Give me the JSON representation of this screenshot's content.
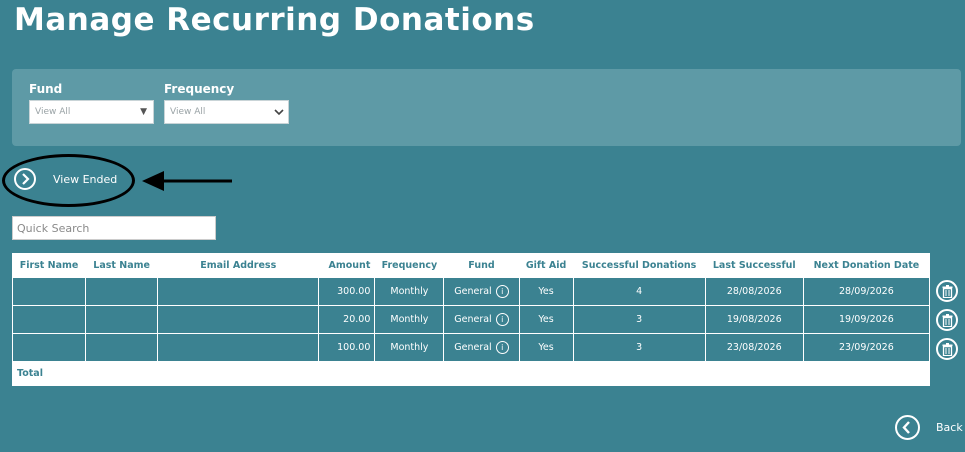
{
  "page": {
    "title": "Manage Recurring Donations"
  },
  "filters": {
    "fund": {
      "label": "Fund",
      "value": "View All"
    },
    "frequency": {
      "label": "Frequency",
      "value": "View All"
    }
  },
  "view_ended": {
    "label": "View Ended"
  },
  "search": {
    "placeholder": "Quick Search"
  },
  "table": {
    "columns": [
      "First Name",
      "Last Name",
      "Email Address",
      "Amount",
      "Frequency",
      "Fund",
      "Gift Aid",
      "Successful Donations",
      "Last Successful",
      "Next Donation Date"
    ],
    "rows": [
      {
        "first_name": "",
        "last_name": "",
        "email": "",
        "amount": "300.00",
        "frequency": "Monthly",
        "fund": "General",
        "gift_aid": "Yes",
        "successful": "4",
        "last_successful": "28/08/2026",
        "next_date": "28/09/2026"
      },
      {
        "first_name": "",
        "last_name": "",
        "email": "",
        "amount": "20.00",
        "frequency": "Monthly",
        "fund": "General",
        "gift_aid": "Yes",
        "successful": "3",
        "last_successful": "19/08/2026",
        "next_date": "19/09/2026"
      },
      {
        "first_name": "",
        "last_name": "",
        "email": "",
        "amount": "100.00",
        "frequency": "Monthly",
        "fund": "General",
        "gift_aid": "Yes",
        "successful": "3",
        "last_successful": "23/08/2026",
        "next_date": "23/09/2026"
      }
    ],
    "total_label": "Total",
    "info_glyph": "i"
  },
  "back": {
    "label": "Back"
  },
  "colors": {
    "background": "#3b8291",
    "panel": "#5e9aa6",
    "header_text": "#3b8291",
    "annotation": "#000000"
  },
  "icons": [
    "chevron-down-icon",
    "chevron-right-icon",
    "chevron-left-icon",
    "info-icon",
    "trash-icon",
    "arrow-left-icon"
  ]
}
